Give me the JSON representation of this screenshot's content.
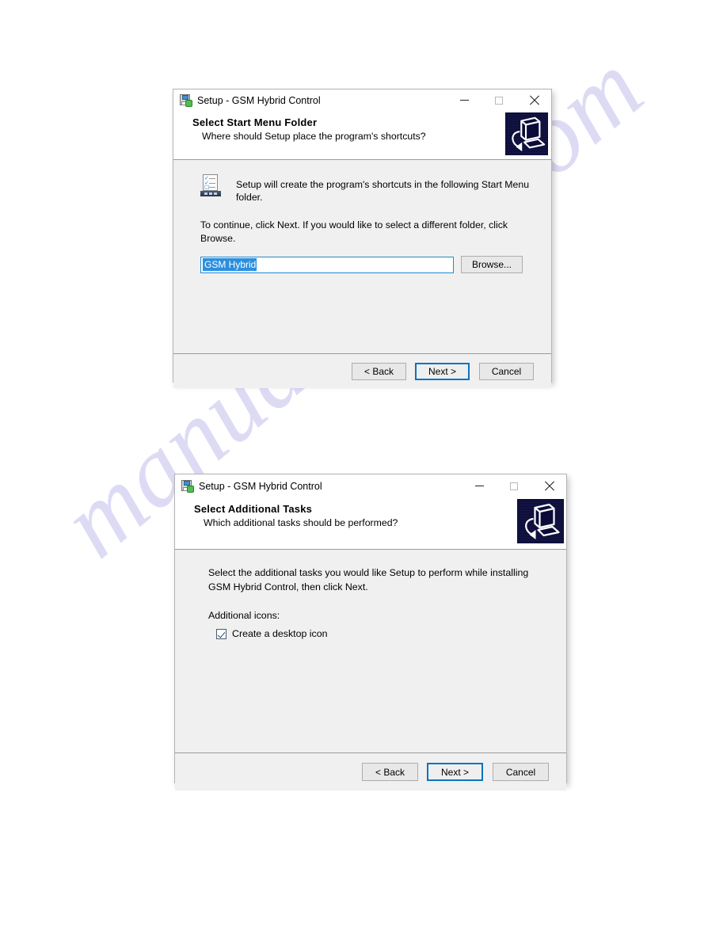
{
  "page": {
    "watermark": "manualshive.com",
    "watermark_color": "#c9c6ee",
    "background": "#ffffff"
  },
  "accent": {
    "focus_border": "#0a73c2",
    "selection_bg": "#2a8fe0",
    "field_border": "#1f8ccc",
    "banner_bg": "#0b0b3a"
  },
  "dialogs": [
    {
      "titlebar": {
        "icon": "setup-disk-icon",
        "title": "Setup - GSM Hybrid Control",
        "minimize_label": "minimize-icon",
        "maximize_label": "maximize-icon",
        "close_label": "close-icon"
      },
      "header": {
        "title": "Select Start Menu Folder",
        "subtitle": "Where should Setup place the program's shortcuts?",
        "banner_icon": "computer-install-icon"
      },
      "body": {
        "icon": "start-menu-folder-icon",
        "intro": "Setup will create the program's shortcuts in the following Start Menu folder.",
        "instruction": "To continue, click Next. If you would like to select a different folder, click Browse.",
        "folder_field": {
          "value": "GSM Hybrid",
          "placeholder": "GSM Hybrid",
          "selected": true
        },
        "browse_label": "Browse..."
      },
      "footer": {
        "back_label": "< Back",
        "next_label": "Next >",
        "cancel_label": "Cancel"
      }
    },
    {
      "titlebar": {
        "icon": "setup-disk-icon",
        "title": "Setup - GSM Hybrid Control",
        "minimize_label": "minimize-icon",
        "maximize_label": "maximize-icon",
        "close_label": "close-icon"
      },
      "header": {
        "title": "Select Additional Tasks",
        "subtitle": "Which additional tasks should be performed?",
        "banner_icon": "computer-install-icon"
      },
      "body": {
        "intro": "Select the additional tasks you would like Setup to perform while installing GSM Hybrid Control, then click Next.",
        "group_label": "Additional icons:",
        "checkbox": {
          "label": "Create a desktop icon",
          "checked": true
        }
      },
      "footer": {
        "back_label": "< Back",
        "next_label": "Next >",
        "cancel_label": "Cancel"
      }
    }
  ]
}
